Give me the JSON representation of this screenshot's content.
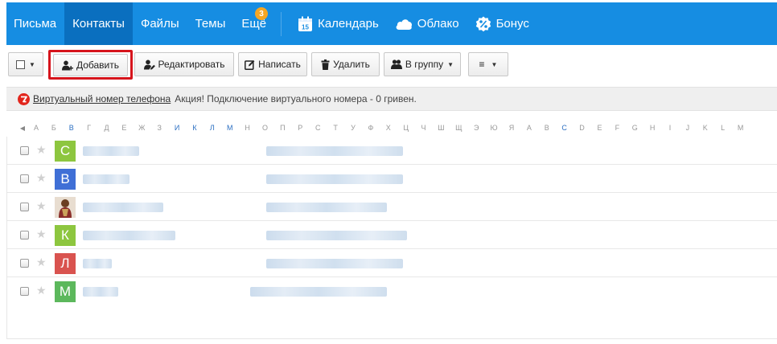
{
  "nav": {
    "items": [
      {
        "label": "Письма",
        "active": false
      },
      {
        "label": "Контакты",
        "active": true
      },
      {
        "label": "Файлы",
        "active": false
      },
      {
        "label": "Темы",
        "active": false
      },
      {
        "label": "Ещё",
        "active": false,
        "badge": "3"
      }
    ],
    "services": [
      {
        "label": "Календарь",
        "icon": "calendar-icon",
        "icon_text": "15"
      },
      {
        "label": "Облако",
        "icon": "cloud-icon"
      },
      {
        "label": "Бонус",
        "icon": "bonus-icon"
      }
    ],
    "accent": "#168de2"
  },
  "toolbar": {
    "add_label": "Добавить",
    "edit_label": "Редактировать",
    "write_label": "Написать",
    "delete_label": "Удалить",
    "group_label": "В группу",
    "more_icon": "≡",
    "highlight_color": "#d6141c"
  },
  "promo": {
    "link": "Виртуальный номер телефона",
    "text": "Акция! Подключение виртуального номера - 0 гривен."
  },
  "alphabet": {
    "prev": "◀",
    "letters": [
      "А",
      "Б",
      "В",
      "Г",
      "Д",
      "Е",
      "Ж",
      "З",
      "И",
      "К",
      "Л",
      "М",
      "Н",
      "О",
      "П",
      "Р",
      "С",
      "Т",
      "У",
      "Ф",
      "Х",
      "Ц",
      "Ч",
      "Ш",
      "Щ",
      "Э",
      "Ю",
      "Я",
      "A",
      "B",
      "C",
      "D",
      "E",
      "F",
      "G",
      "H",
      "I",
      "J",
      "K",
      "L",
      "M"
    ],
    "active": [
      "В",
      "И",
      "К",
      "Л",
      "М",
      "C"
    ]
  },
  "contacts": [
    {
      "letter": "С",
      "color": "#8dc63f"
    },
    {
      "letter": "В",
      "color": "#3f6fd6"
    },
    {
      "letter": "",
      "color": "#b58a5a",
      "photo": true
    },
    {
      "letter": "К",
      "color": "#8dc63f"
    },
    {
      "letter": "Л",
      "color": "#d9534f"
    },
    {
      "letter": "М",
      "color": "#5cb85c"
    }
  ]
}
